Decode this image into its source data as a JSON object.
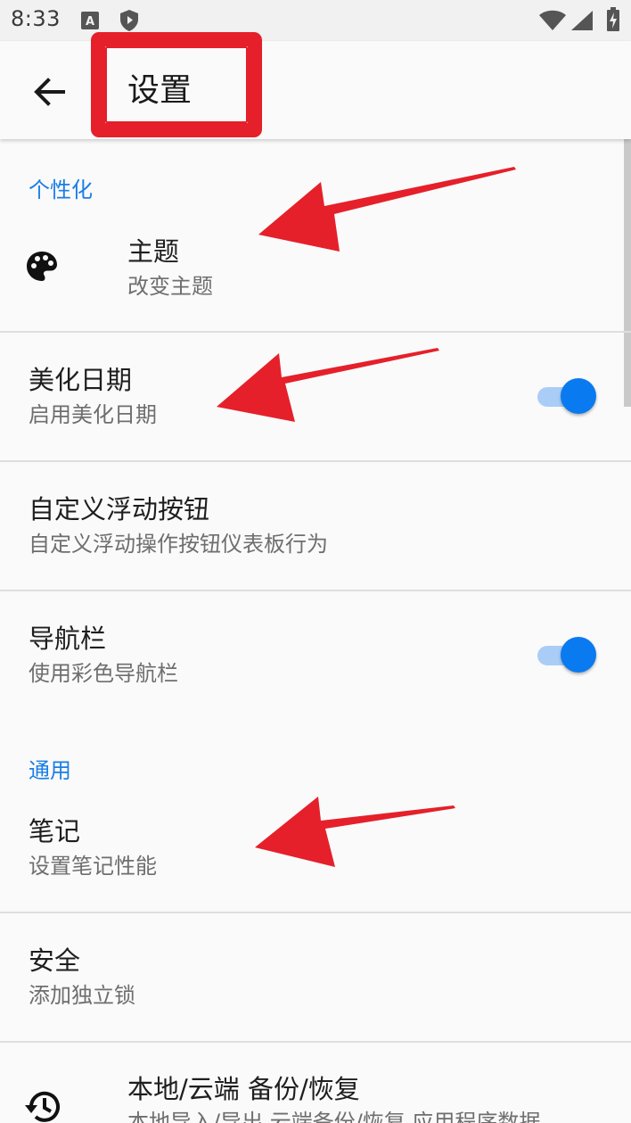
{
  "status_bar": {
    "time": "8:33",
    "icons": [
      "a-notification-icon",
      "shield-icon",
      "wifi-icon",
      "cell-signal-icon",
      "battery-charging-icon"
    ]
  },
  "app_bar": {
    "title": "设置"
  },
  "sections": {
    "personalization": "个性化",
    "general": "通用"
  },
  "items": {
    "theme": {
      "title": "主题",
      "subtitle": "改变主题",
      "icon": "palette-icon"
    },
    "beautify_date": {
      "title": "美化日期",
      "subtitle": "启用美化日期",
      "enabled": true
    },
    "custom_fab": {
      "title": "自定义浮动按钮",
      "subtitle": "自定义浮动操作按钮仪表板行为"
    },
    "nav_bar": {
      "title": "导航栏",
      "subtitle": "使用彩色导航栏",
      "enabled": true
    },
    "notes": {
      "title": "笔记",
      "subtitle": "设置笔记性能"
    },
    "security": {
      "title": "安全",
      "subtitle": "添加独立锁"
    },
    "backup": {
      "title": "本地/云端 备份/恢复",
      "subtitle": "本地导入/导出 云端备份/恢复 应用程序数据",
      "icon": "backup-restore-icon"
    }
  },
  "colors": {
    "accent": "#0a7af0",
    "section_header": "#1a7ee6",
    "annotation": "#e5202a"
  }
}
